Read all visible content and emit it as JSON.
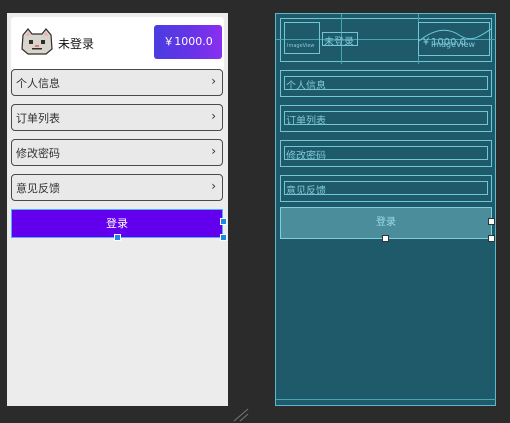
{
  "header": {
    "username": "未登录",
    "balance": "￥1000.0"
  },
  "menu": {
    "items": [
      {
        "label": "个人信息",
        "chevron": "›"
      },
      {
        "label": "订单列表",
        "chevron": "›"
      },
      {
        "label": "修改密码",
        "chevron": "›"
      },
      {
        "label": "意见反馈",
        "chevron": "›"
      }
    ]
  },
  "login_button": "登录",
  "blueprint": {
    "avatar_label": "ImageView",
    "username": "未登录",
    "balance": "￥1000.0",
    "balance_image_label": "ImageView",
    "menu_items": [
      "个人信息",
      "订单列表",
      "修改密码",
      "意见反馈"
    ],
    "login_button": "登录"
  },
  "colors": {
    "editor_bg": "#2b2b2b",
    "design_bg": "#ececec",
    "primary": "#6200ee",
    "blueprint_bg": "#1f5a6b",
    "selection": "#1e88e5"
  },
  "icons": {
    "avatar": "cat-avatar-icon",
    "chevron": "chevron-right-icon"
  }
}
